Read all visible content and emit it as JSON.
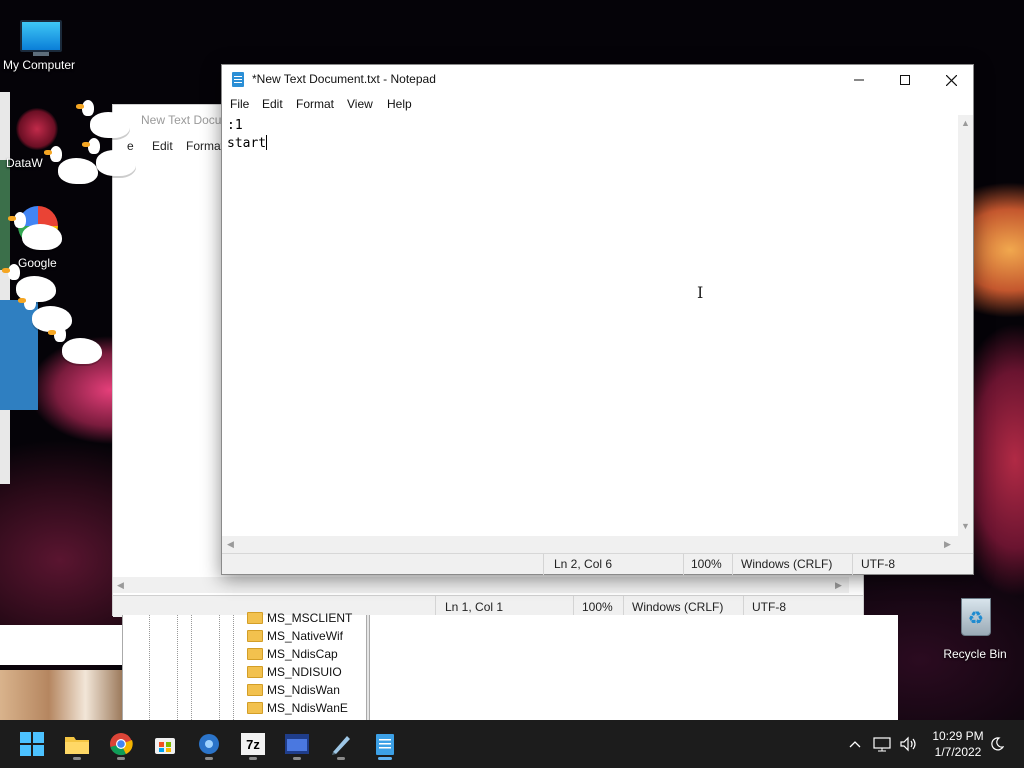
{
  "desktop": {
    "icons": [
      {
        "label": "My Computer"
      },
      {
        "label": "DataW"
      },
      {
        "label": "Google"
      },
      {
        "label": "Recycle Bin"
      }
    ]
  },
  "background_notepad": {
    "title": "New Text Docu",
    "menu": [
      "e",
      "Edit",
      "Format"
    ],
    "status": {
      "position": "Ln 1, Col 1",
      "zoom": "100%",
      "line_ending": "Windows (CRLF)",
      "encoding": "UTF-8"
    }
  },
  "registry_keys": [
    "MS_MSCLIENT",
    "MS_NativeWif",
    "MS_NdisCap",
    "MS_NDISUIO",
    "MS_NdisWan",
    "MS_NdisWanE"
  ],
  "notepad": {
    "title": "*New Text Document.txt - Notepad",
    "menu": {
      "file": "File",
      "edit": "Edit",
      "format": "Format",
      "view": "View",
      "help": "Help"
    },
    "lines": [
      ":1",
      "start"
    ],
    "status": {
      "position": "Ln 2, Col 6",
      "zoom": "100%",
      "line_ending": "Windows (CRLF)",
      "encoding": "UTF-8"
    }
  },
  "taskbar": {
    "apps": [
      "start-icon",
      "file-explorer-icon",
      "chrome-icon",
      "store-icon",
      "app-icon",
      "7zip-icon",
      "app-icon",
      "app-icon",
      "notepad-icon"
    ],
    "sevenzip_label": "7z",
    "clock": {
      "time": "10:29 PM",
      "date": "1/7/2022"
    }
  }
}
